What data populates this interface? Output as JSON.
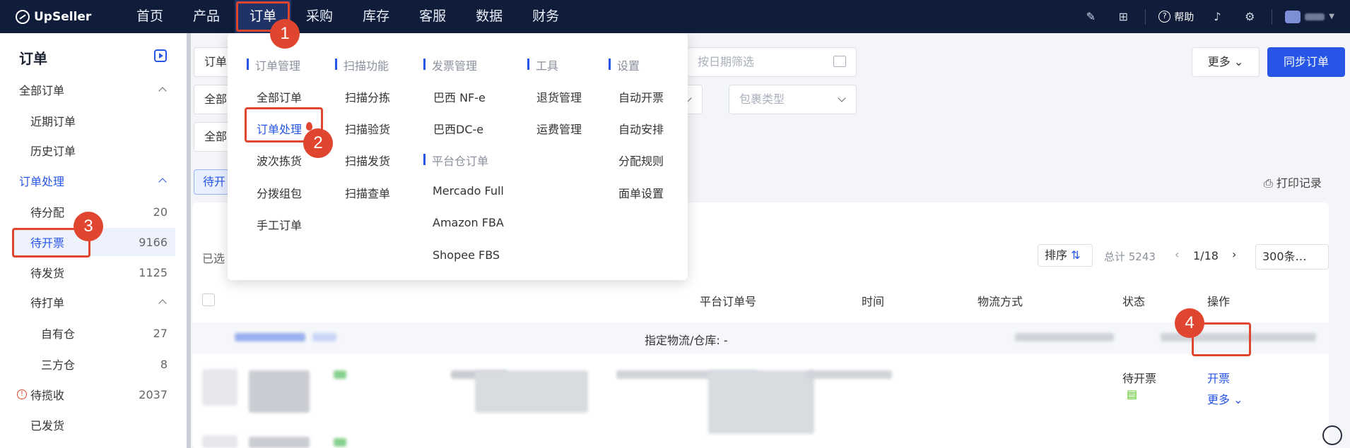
{
  "brand": "UpSeller",
  "nav": [
    "首页",
    "产品",
    "订单",
    "采购",
    "库存",
    "客服",
    "数据",
    "财务"
  ],
  "topright": {
    "help": "帮助"
  },
  "sidebar": {
    "title": "订单",
    "items": [
      {
        "label": "全部订单",
        "level": 1
      },
      {
        "label": "近期订单",
        "level": 2
      },
      {
        "label": "历史订单",
        "level": 2
      },
      {
        "label": "订单处理",
        "level": 1
      },
      {
        "label": "待分配",
        "level": 2,
        "count": "20"
      },
      {
        "label": "待开票",
        "level": 2,
        "count": "9166"
      },
      {
        "label": "待发货",
        "level": 2,
        "count": "1125"
      },
      {
        "label": "待打单",
        "level": 2
      },
      {
        "label": "自有仓",
        "level": 3,
        "count": "27"
      },
      {
        "label": "三方仓",
        "level": 3,
        "count": "8"
      },
      {
        "label": "待揽收",
        "level": 2,
        "count": "2037"
      },
      {
        "label": "已发货",
        "level": 2
      }
    ]
  },
  "dropdown": {
    "columns": [
      {
        "head": "订单管理",
        "items": [
          "全部订单",
          "订单处理",
          "波次拣货",
          "分拨组包",
          "手工订单"
        ]
      },
      {
        "head": "扫描功能",
        "items": [
          "扫描分拣",
          "扫描验货",
          "扫描发货",
          "扫描查单"
        ]
      },
      {
        "head": "发票管理",
        "items": [
          "巴西 NF-e",
          "巴西DC-e"
        ]
      },
      {
        "head": "平台仓订单",
        "items": [
          "Mercado Full",
          "Amazon FBA",
          "Shopee FBS"
        ]
      },
      {
        "head": "工具",
        "items": [
          "退货管理",
          "运费管理"
        ]
      },
      {
        "head": "设置",
        "items": [
          "自动开票",
          "自动安排",
          "分配规则",
          "面单设置"
        ]
      }
    ]
  },
  "filters": {
    "order_select": "订单",
    "date_placeholder": "按日期筛选",
    "all_1": "全部",
    "package_placeholder": "包裹类型",
    "all_2": "全部"
  },
  "actions": {
    "more": "更多",
    "sync": "同步订单"
  },
  "tab_pill": "待开",
  "print_log": "打印记录",
  "list_toolbar": {
    "selected": "已选",
    "sort": "排序",
    "total": "总计 5243",
    "page": "1/18",
    "page_size": "300条…"
  },
  "table": {
    "headers": [
      "平台订单号",
      "时间",
      "物流方式",
      "状态",
      "操作"
    ],
    "group_text": "指定物流/仓库: -",
    "row": {
      "status": "待开票",
      "action_primary": "开票",
      "action_more": "更多"
    }
  },
  "badges": [
    "1",
    "2",
    "3",
    "4"
  ]
}
